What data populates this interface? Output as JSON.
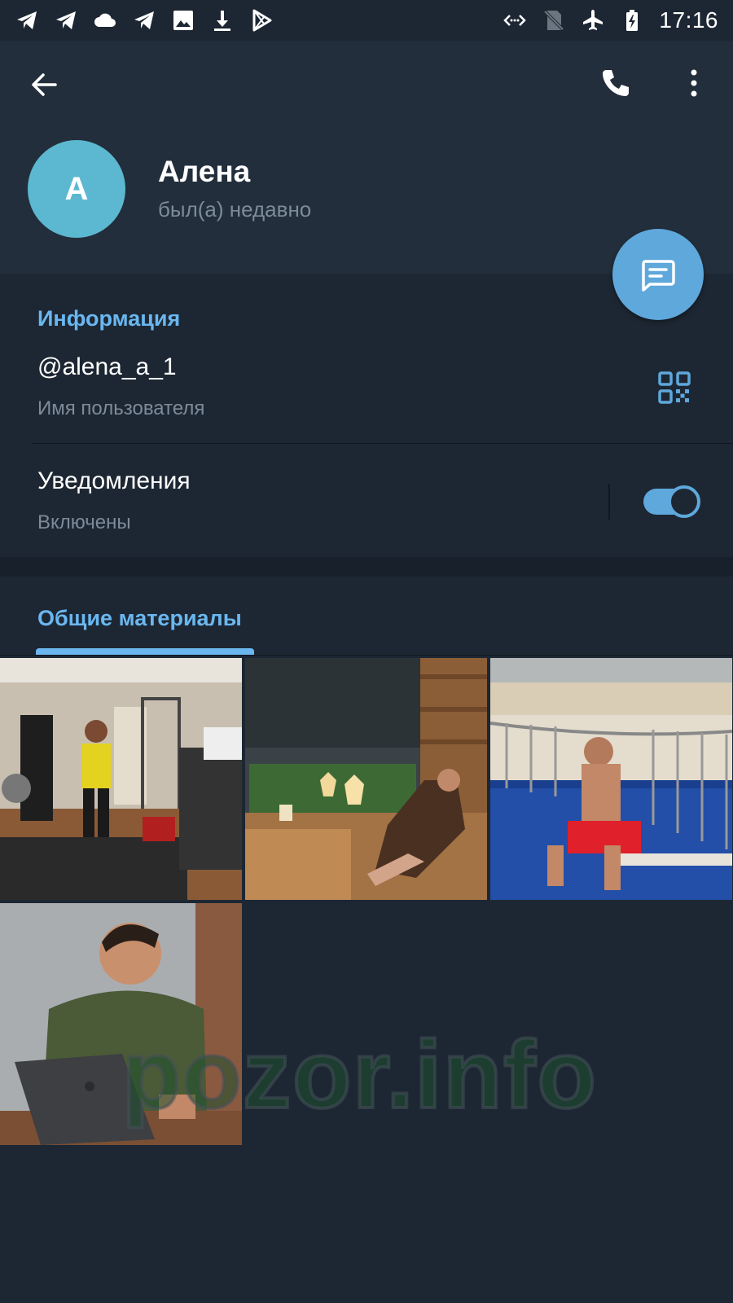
{
  "status_bar": {
    "time": "17:16",
    "left_icons": [
      "telegram-icon",
      "telegram-icon",
      "cloud-icon",
      "telegram-icon",
      "image-icon",
      "download-icon",
      "play-store-icon"
    ],
    "right_icons": [
      "data-saver-icon",
      "no-sim-icon",
      "airplane-icon",
      "battery-charging-icon"
    ]
  },
  "header": {
    "avatar_letter": "А",
    "name": "Алена",
    "status": "был(а) недавно"
  },
  "info": {
    "title": "Информация",
    "username": "@alena_a_1",
    "username_caption": "Имя пользователя",
    "notifications_title": "Уведомления",
    "notifications_caption": "Включены",
    "notifications_enabled": true
  },
  "media": {
    "tab_label": "Общие материалы",
    "thumbnails": [
      {
        "description": "gym-selfie-photo"
      },
      {
        "description": "sauna-lounge-photo"
      },
      {
        "description": "pool-beach-photo"
      },
      {
        "description": "laptop-portrait-photo"
      }
    ]
  },
  "watermark": "pozor.info",
  "colors": {
    "background": "#1d2733",
    "header": "#222e3b",
    "accent": "#6ab7f0",
    "fab": "#5ea8dc",
    "avatar": "#5cb8d0",
    "secondary_text": "#7d8b99"
  }
}
